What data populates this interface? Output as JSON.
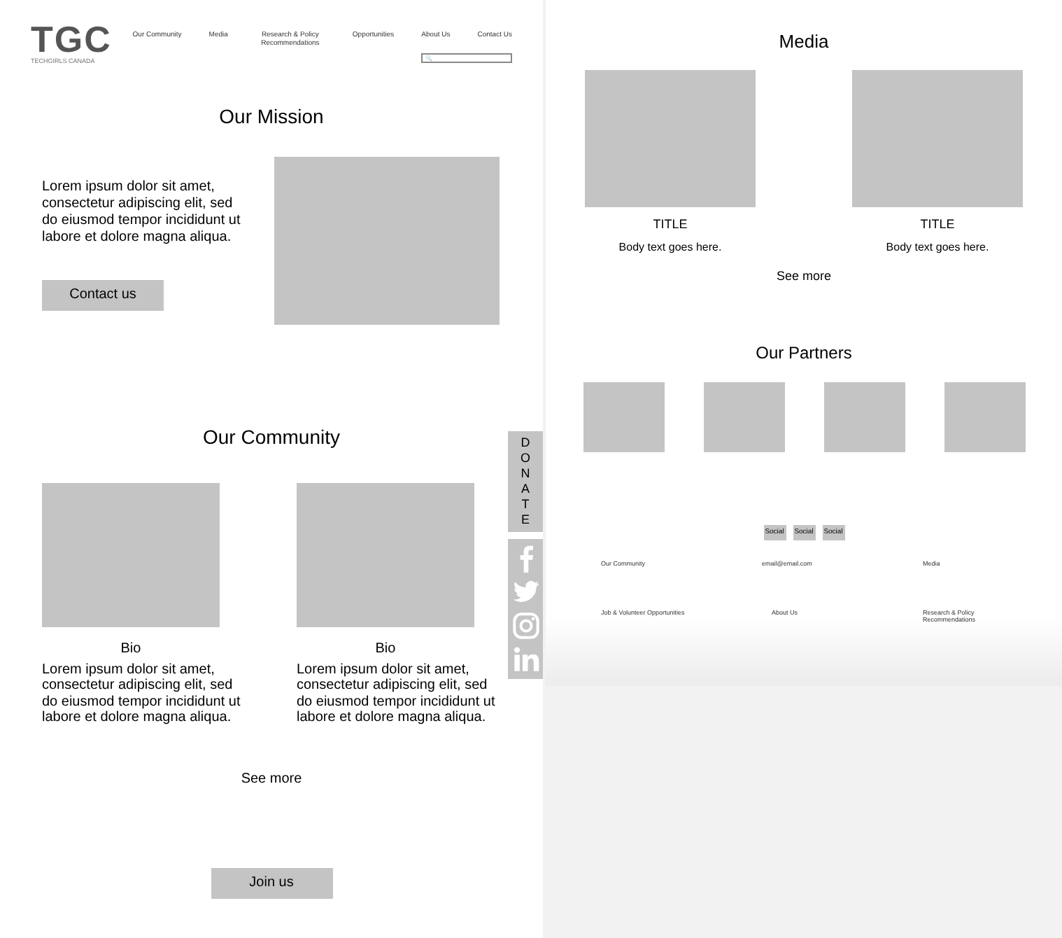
{
  "logo": {
    "mark": "TGC",
    "tagline": "TECHGIRLS CANADA"
  },
  "nav": [
    {
      "label": "Our Community"
    },
    {
      "label": "Media"
    },
    {
      "label": "Research & Policy Recommendations"
    },
    {
      "label": "Opportunities"
    },
    {
      "label": "About Us"
    },
    {
      "label": "Contact Us"
    }
  ],
  "search": {
    "placeholder": "🔍"
  },
  "mission": {
    "title": "Our Mission",
    "body": "Lorem ipsum dolor sit amet, consectetur adipiscing elit, sed do eiusmod tempor incididunt ut labore et dolore magna aliqua.",
    "button": "Contact us"
  },
  "community": {
    "title": "Our Community",
    "cards": [
      {
        "caption": "Bio",
        "body": "Lorem ipsum dolor sit amet, consectetur adipiscing elit, sed do eiusmod tempor incididunt ut labore et dolore magna aliqua."
      },
      {
        "caption": "Bio",
        "body": "Lorem ipsum dolor sit amet, consectetur adipiscing elit, sed do eiusmod tempor incididunt ut labore et dolore magna aliqua."
      }
    ],
    "see_more": "See more",
    "button": "Join us"
  },
  "donate": {
    "letters": [
      "D",
      "O",
      "N",
      "A",
      "T",
      "E"
    ]
  },
  "social_sidebar": [
    {
      "kind": "facebook"
    },
    {
      "kind": "twitter"
    },
    {
      "kind": "instagram"
    },
    {
      "kind": "linkedin"
    }
  ],
  "media": {
    "title": "Media",
    "cards": [
      {
        "title": "TITLE",
        "body": "Body text goes here."
      },
      {
        "title": "TITLE",
        "body": "Body text goes here."
      }
    ],
    "see_more": "See more"
  },
  "partners": {
    "title": "Our Partners"
  },
  "footer": {
    "social_buttons": [
      "Social",
      "Social",
      "Social"
    ],
    "links": [
      "Our Community",
      "email@email.com",
      "Media",
      "Job & Volunteer Opportunities",
      "About Us",
      "Research & Policy Recommendations"
    ]
  }
}
